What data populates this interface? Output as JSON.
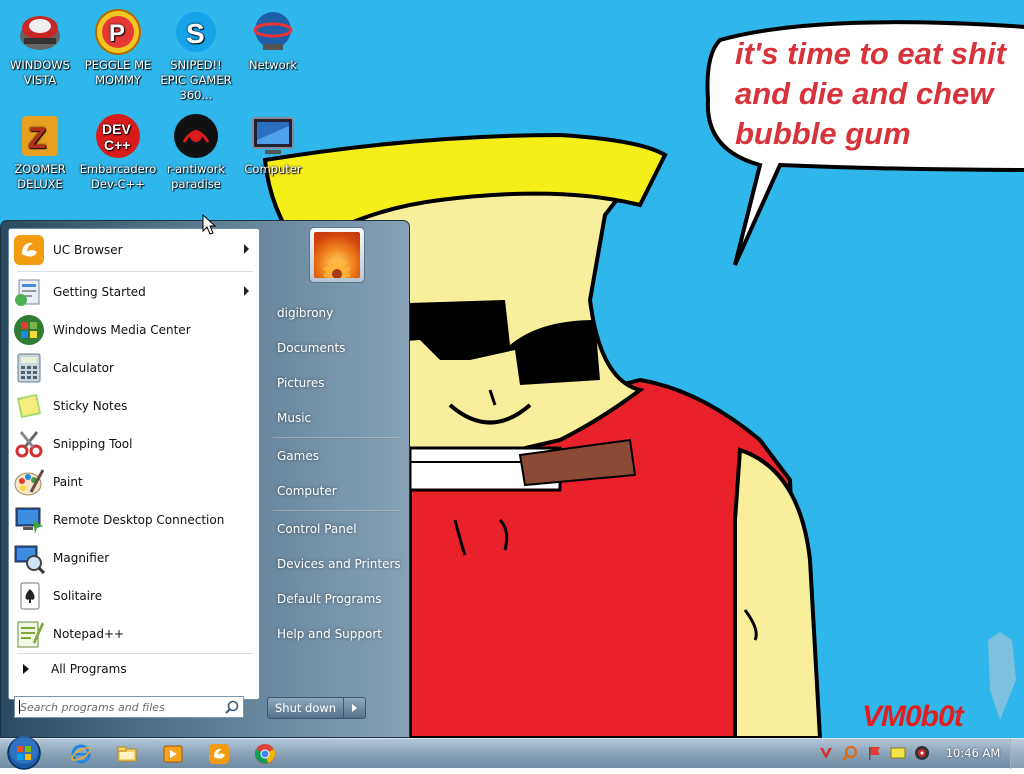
{
  "wallpaper": {
    "speech_lines": [
      "it's time to eat shit",
      "and die and chew",
      "bubble gum"
    ],
    "signature": "VM0b0t"
  },
  "desktop_icons": [
    {
      "label": "WINDOWS VISTA",
      "icon": "windows-vista-icon"
    },
    {
      "label": "PEGGLE ME MOMMY",
      "icon": "peggle-icon"
    },
    {
      "label": "SNIPED!! EPIC GAMER 360...",
      "icon": "skype-icon"
    },
    {
      "label": "Network",
      "icon": "network-icon"
    },
    {
      "label": "ZOOMER DELUXE",
      "icon": "zoomer-icon"
    },
    {
      "label": "Embarcadero Dev-C++",
      "icon": "devcpp-icon"
    },
    {
      "label": "r-antiwork paradise",
      "icon": "antiwork-icon"
    },
    {
      "label": "Computer",
      "icon": "computer-icon"
    }
  ],
  "start_menu": {
    "programs": [
      {
        "label": "UC Browser",
        "icon": "uc-browser-icon",
        "submenu": true
      },
      {
        "label": "Getting Started",
        "icon": "getting-started-icon",
        "submenu": true
      },
      {
        "label": "Windows Media Center",
        "icon": "media-center-icon",
        "submenu": false
      },
      {
        "label": "Calculator",
        "icon": "calculator-icon",
        "submenu": false
      },
      {
        "label": "Sticky Notes",
        "icon": "sticky-notes-icon",
        "submenu": false
      },
      {
        "label": "Snipping Tool",
        "icon": "snipping-tool-icon",
        "submenu": false
      },
      {
        "label": "Paint",
        "icon": "paint-icon",
        "submenu": false
      },
      {
        "label": "Remote Desktop Connection",
        "icon": "remote-desktop-icon",
        "submenu": false
      },
      {
        "label": "Magnifier",
        "icon": "magnifier-icon",
        "submenu": false
      },
      {
        "label": "Solitaire",
        "icon": "solitaire-icon",
        "submenu": false
      },
      {
        "label": "Notepad++",
        "icon": "notepadpp-icon",
        "submenu": false
      }
    ],
    "all_programs": "All Programs",
    "search_placeholder": "Search programs and files",
    "right_items": [
      "digibrony",
      "Documents",
      "Pictures",
      "Music",
      "Games",
      "Computer",
      "Control Panel",
      "Devices and Printers",
      "Default Programs",
      "Help and Support"
    ],
    "shutdown_label": "Shut down"
  },
  "taskbar": {
    "pinned": [
      "internet-explorer-icon",
      "windows-explorer-icon",
      "media-player-icon",
      "uc-browser-icon",
      "chrome-icon"
    ],
    "tray": [
      "vivaldi-icon",
      "search-tray-icon",
      "flag-icon",
      "message-icon",
      "volume-icon"
    ],
    "clock": "10:46 AM"
  }
}
